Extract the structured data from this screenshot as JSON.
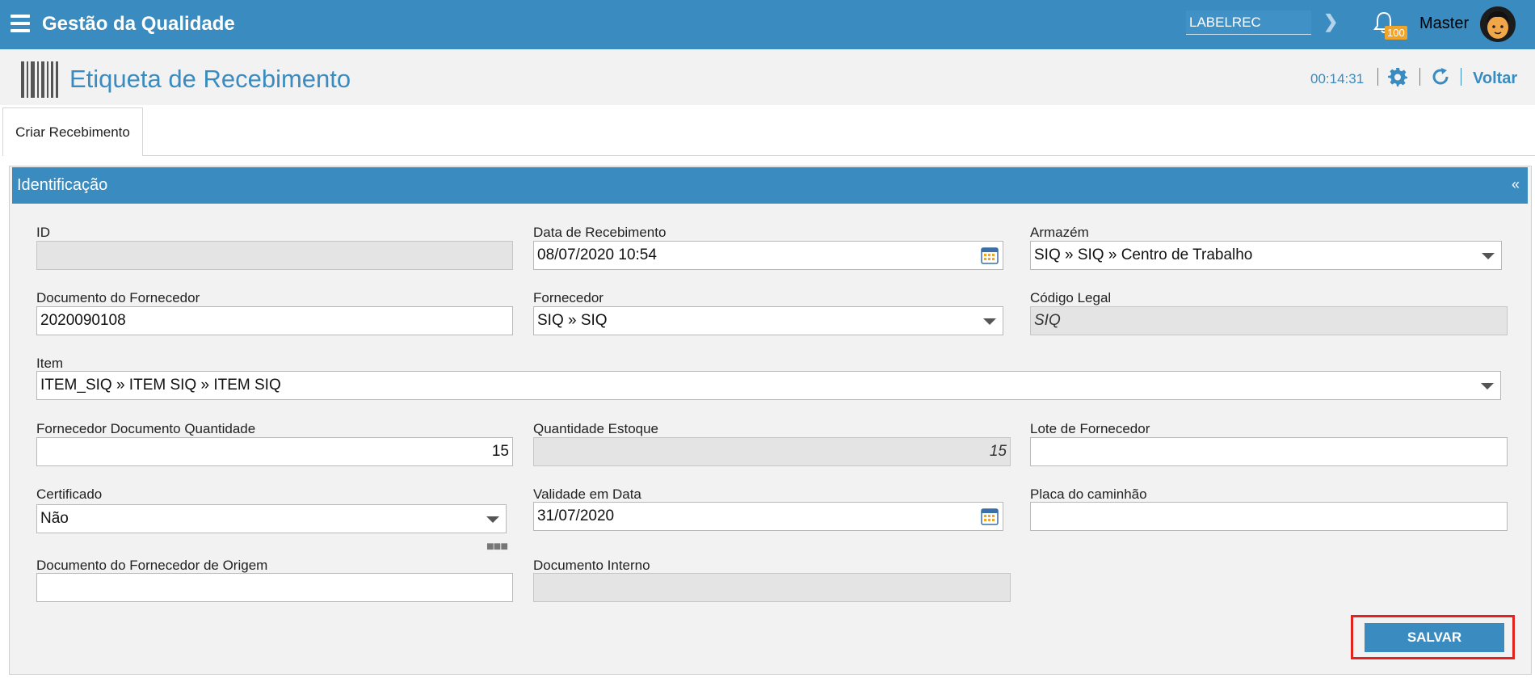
{
  "app": {
    "title": "Gestão da Qualidade"
  },
  "topbar": {
    "search_value": "LABELREC",
    "notification_count": "100",
    "user_name": "Master"
  },
  "page": {
    "title": "Etiqueta de Recebimento",
    "timer": "00:14:31",
    "back_label": "Voltar"
  },
  "tabs": [
    {
      "label": "Criar Recebimento"
    }
  ],
  "section": {
    "title": "Identificação",
    "collapse_symbol": "«"
  },
  "fields": {
    "id": {
      "label": "ID",
      "value": ""
    },
    "data_recebimento": {
      "label": "Data de Recebimento",
      "value": "08/07/2020 10:54"
    },
    "armazem": {
      "label": "Armazém",
      "value": "SIQ » SIQ » Centro de Trabalho"
    },
    "documento_fornecedor": {
      "label": "Documento do Fornecedor",
      "value": "2020090108"
    },
    "fornecedor": {
      "label": "Fornecedor",
      "value": "SIQ » SIQ"
    },
    "codigo_legal": {
      "label": "Código Legal",
      "value": "SIQ"
    },
    "item": {
      "label": "Item",
      "value": "ITEM_SIQ » ITEM SIQ » ITEM SIQ"
    },
    "fornecedor_doc_qtd": {
      "label": "Fornecedor Documento Quantidade",
      "value": "15"
    },
    "quantidade_estoque": {
      "label": "Quantidade Estoque",
      "value": "15"
    },
    "lote_fornecedor": {
      "label": "Lote de Fornecedor",
      "value": ""
    },
    "certificado": {
      "label": "Certificado",
      "value": "Não"
    },
    "validade_data": {
      "label": "Validade em Data",
      "value": "31/07/2020"
    },
    "placa_caminhao": {
      "label": "Placa do caminhão",
      "value": ""
    },
    "documento_origem": {
      "label": "Documento do Fornecedor de Origem",
      "value": ""
    },
    "documento_interno": {
      "label": "Documento Interno",
      "value": ""
    }
  },
  "actions": {
    "save_label": "SALVAR"
  },
  "colors": {
    "primary": "#3a8bbf",
    "highlight": "#e5231e",
    "badge": "#f0a52a"
  },
  "icons": [
    "menu-icon",
    "chevron-right-icon",
    "bell-icon",
    "avatar",
    "barcode-icon",
    "gear-icon",
    "refresh-icon",
    "calendar-icon",
    "caret-down-icon",
    "more-icon"
  ]
}
